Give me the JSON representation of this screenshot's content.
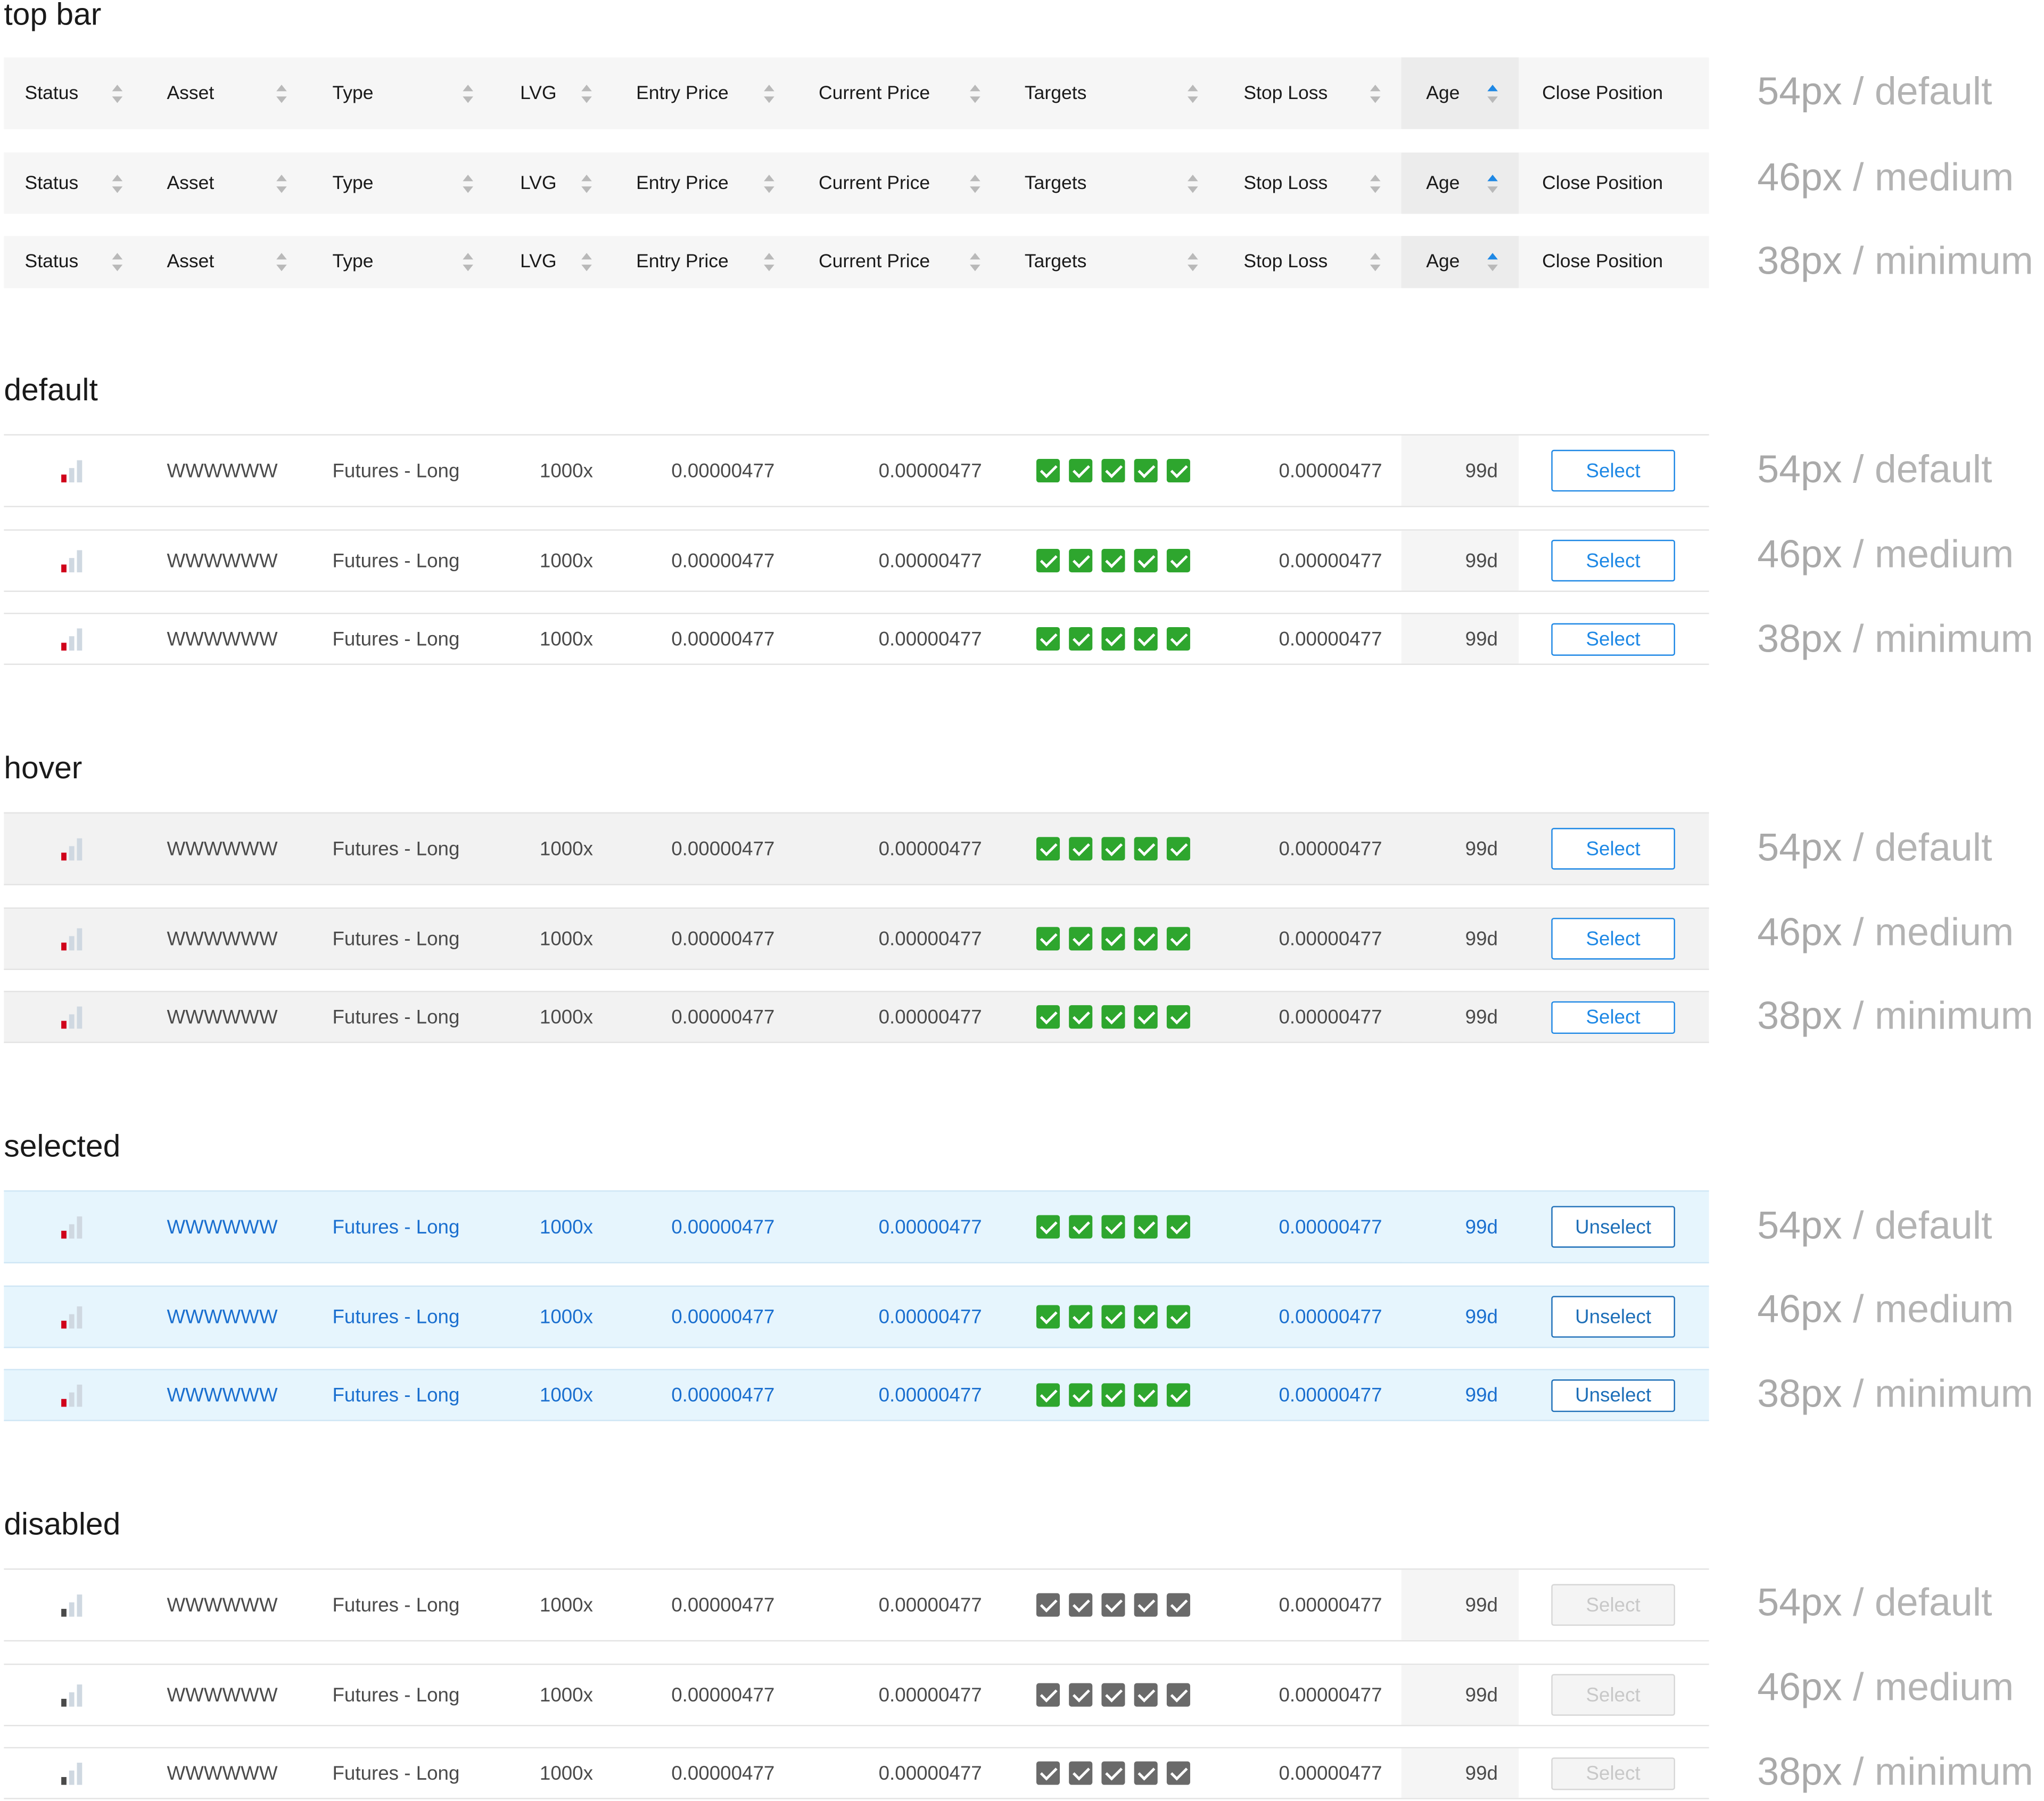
{
  "columns": [
    {
      "key": "status",
      "label": "Status",
      "sortable": true
    },
    {
      "key": "asset",
      "label": "Asset",
      "sortable": true
    },
    {
      "key": "type",
      "label": "Type",
      "sortable": true
    },
    {
      "key": "lvg",
      "label": "LVG",
      "sortable": true
    },
    {
      "key": "entry",
      "label": "Entry Price",
      "sortable": true
    },
    {
      "key": "current",
      "label": "Current Price",
      "sortable": true
    },
    {
      "key": "targets",
      "label": "Targets",
      "sortable": true
    },
    {
      "key": "stop",
      "label": "Stop Loss",
      "sortable": true
    },
    {
      "key": "age",
      "label": "Age",
      "sortable": true,
      "active_sort": true
    },
    {
      "key": "close",
      "label": "Close Position",
      "sortable": false
    }
  ],
  "row_values": {
    "asset": "WWWWWW",
    "type": "Futures - Long",
    "lvg": "1000x",
    "entry": "0.00000477",
    "current": "0.00000477",
    "stop": "0.00000477",
    "age": "99d",
    "targets_count": 5
  },
  "sizes": [
    {
      "px": "54px",
      "sep": "/",
      "name": "default"
    },
    {
      "px": "46px",
      "sep": "/",
      "name": "medium"
    },
    {
      "px": "38px",
      "sep": "/",
      "name": "minimum"
    }
  ],
  "sections": [
    {
      "id": "topbar",
      "title": "top bar"
    },
    {
      "id": "default",
      "title": "default",
      "button": "Select"
    },
    {
      "id": "hover",
      "title": "hover",
      "button": "Select"
    },
    {
      "id": "selected",
      "title": "selected",
      "button": "Unselect"
    },
    {
      "id": "disabled",
      "title": "disabled",
      "button": "Select"
    }
  ],
  "colors": {
    "accent": "#1e88e5",
    "target_active": "#2ea62e",
    "target_disabled": "#6a6a6a",
    "status_active": "#d0021b",
    "status_disabled": "#4a4a4a",
    "selected_bg": "#e6f5fd",
    "selected_text": "#1a6fcf",
    "hover_bg": "#f2f2f2",
    "header_bg": "#f6f6f6",
    "size_label": "#b3b3b3"
  },
  "icons": {
    "status": "signal-bars-icon",
    "sort": "sort-arrows-icon",
    "target": "checkbox-checked-icon"
  }
}
